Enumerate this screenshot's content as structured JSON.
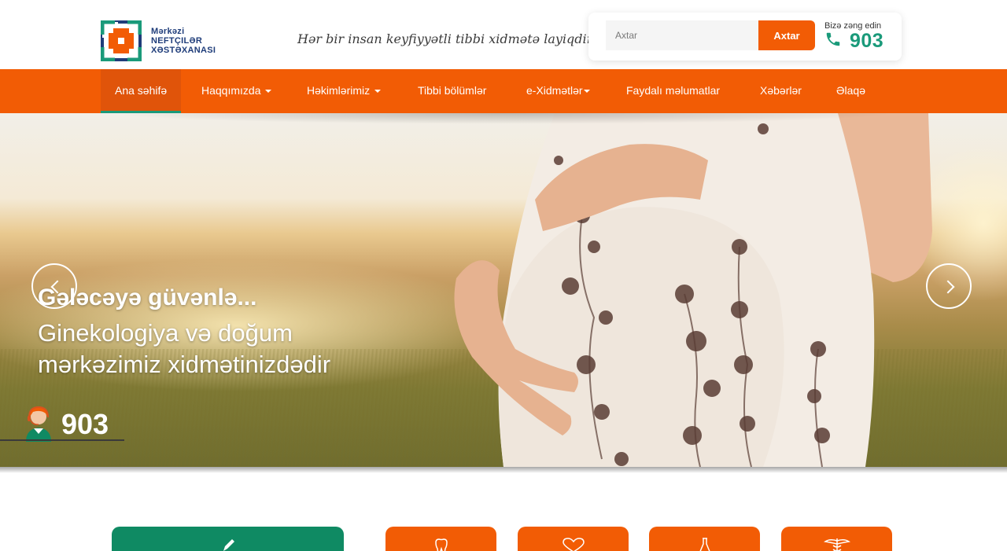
{
  "header": {
    "logo_lines": [
      "Mərkəzi",
      "Neftçilər",
      "Xəstəxanası"
    ],
    "tagline": "Hər bir insan keyfiyyətli tibbi xidmətə layiqdir.",
    "search": {
      "placeholder": "Axtar",
      "button_label": "Axtar"
    },
    "call": {
      "label": "Bizə zəng edin",
      "number": "903",
      "icon": "phone-icon"
    }
  },
  "nav": {
    "items": [
      {
        "label": "Ana səhifə",
        "active": true,
        "dropdown": false
      },
      {
        "label": "Haqqımızda",
        "active": false,
        "dropdown": true
      },
      {
        "label": "Həkimlərimiz",
        "active": false,
        "dropdown": true
      },
      {
        "label": "Tibbi bölümlər",
        "active": false,
        "dropdown": false
      },
      {
        "label": "e-Xidmətlər",
        "active": false,
        "dropdown": true
      },
      {
        "label": "Faydalı məlumatlar",
        "active": false,
        "dropdown": false
      },
      {
        "label": "Xəbərlər",
        "active": false,
        "dropdown": false
      },
      {
        "label": "Əlaqə",
        "active": false,
        "dropdown": false
      }
    ]
  },
  "hero": {
    "title": "Gələcəyə güvənlə...",
    "subtitle_line1": "Ginekologiya və doğum",
    "subtitle_line2": "mərkəzimiz xidmətinizdədir",
    "hotline_number": "903",
    "hotline_icon": "operator-icon",
    "prev_icon": "chevron-left-icon",
    "next_icon": "chevron-right-icon"
  },
  "cards": [
    {
      "color": "#0f8a63",
      "icon": "pen-icon"
    },
    {
      "color": "#f25c05",
      "icon": "tooth-icon"
    },
    {
      "color": "#f25c05",
      "icon": "heart-icon"
    },
    {
      "color": "#f25c05",
      "icon": "flask-icon"
    },
    {
      "color": "#f25c05",
      "icon": "caduceus-icon"
    }
  ],
  "colors": {
    "brand_orange": "#f25c05",
    "brand_green": "#1a9a7a",
    "brand_navy": "#1f3d7a"
  }
}
